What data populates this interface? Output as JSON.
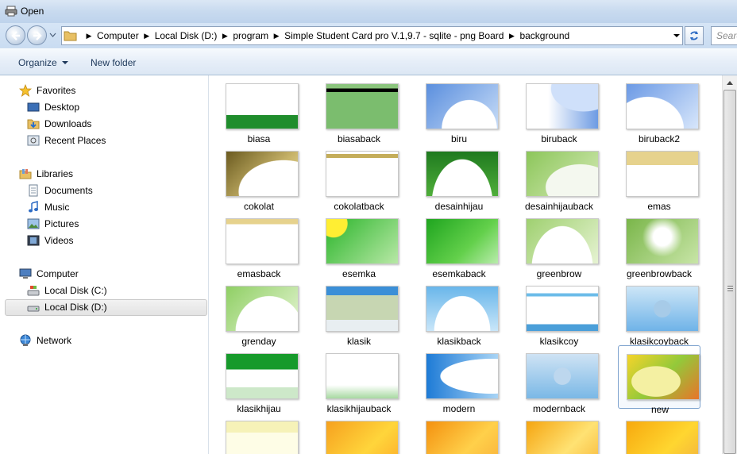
{
  "window": {
    "title": "Open"
  },
  "address": {
    "breadcrumbs": [
      "Computer",
      "Local Disk (D:)",
      "program",
      "Simple Student Card pro V.1,9.7 - sqlite - png Board",
      "background"
    ],
    "search_placeholder": "Search"
  },
  "toolbar": {
    "organize_label": "Organize",
    "new_folder_label": "New folder"
  },
  "sidebar": {
    "favorites": {
      "label": "Favorites",
      "items": [
        {
          "label": "Desktop",
          "icon": "desktop-icon"
        },
        {
          "label": "Downloads",
          "icon": "downloads-icon"
        },
        {
          "label": "Recent Places",
          "icon": "recent-places-icon"
        }
      ]
    },
    "libraries": {
      "label": "Libraries",
      "items": [
        {
          "label": "Documents",
          "icon": "documents-icon"
        },
        {
          "label": "Music",
          "icon": "music-icon"
        },
        {
          "label": "Pictures",
          "icon": "pictures-icon"
        },
        {
          "label": "Videos",
          "icon": "videos-icon"
        }
      ]
    },
    "computer": {
      "label": "Computer",
      "items": [
        {
          "label": "Local Disk (C:)",
          "icon": "drive-c-icon"
        },
        {
          "label": "Local Disk (D:)",
          "icon": "drive-d-icon",
          "selected": true
        }
      ]
    },
    "network": {
      "label": "Network"
    }
  },
  "files": [
    {
      "name": "biasa"
    },
    {
      "name": "biasaback"
    },
    {
      "name": "biru"
    },
    {
      "name": "biruback"
    },
    {
      "name": "biruback2"
    },
    {
      "name": "cokolat"
    },
    {
      "name": "cokolatback"
    },
    {
      "name": "desainhijau"
    },
    {
      "name": "desainhijauback"
    },
    {
      "name": "emas"
    },
    {
      "name": "emasback"
    },
    {
      "name": "esemka"
    },
    {
      "name": "esemkaback"
    },
    {
      "name": "greenbrow"
    },
    {
      "name": "greenbrowback"
    },
    {
      "name": "grenday"
    },
    {
      "name": "klasik"
    },
    {
      "name": "klasikback"
    },
    {
      "name": "klasikcoy"
    },
    {
      "name": "klasikcoyback"
    },
    {
      "name": "klasikhijau"
    },
    {
      "name": "klasikhijauback"
    },
    {
      "name": "modern"
    },
    {
      "name": "modernback"
    },
    {
      "name": "new",
      "selected": true
    },
    {
      "name": ""
    },
    {
      "name": ""
    },
    {
      "name": ""
    },
    {
      "name": ""
    },
    {
      "name": ""
    }
  ],
  "colors": {
    "selection_border": "#7da2ce",
    "link_text": "#1e395b"
  }
}
